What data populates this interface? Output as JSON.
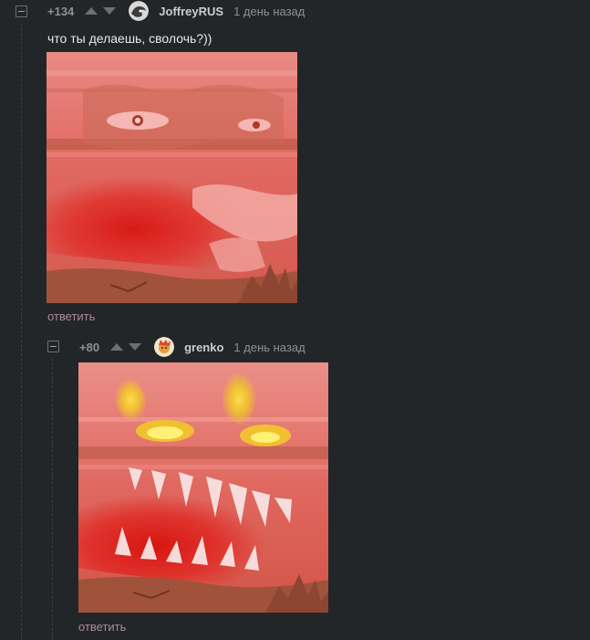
{
  "colors": {
    "background": "#232628",
    "reply_link": "#b0879f",
    "rating": "#8b9095"
  },
  "comments": [
    {
      "rating": "+134",
      "author": "JoffreyRUS",
      "date": "1 день назад",
      "text": "что ты делаешь, сволочь?))",
      "image": "red-blurred-screaming-face-meme",
      "reply_label": "ответить"
    },
    {
      "rating": "+80",
      "author": "grenko",
      "date": "1 день назад",
      "image": "red-blurred-face-flaming-eyes-sharp-teeth-meme",
      "reply_label": "ответить"
    }
  ],
  "icons": {
    "collapse": "minus-square-icon",
    "upvote": "triangle-up-icon",
    "downvote": "triangle-down-icon"
  }
}
